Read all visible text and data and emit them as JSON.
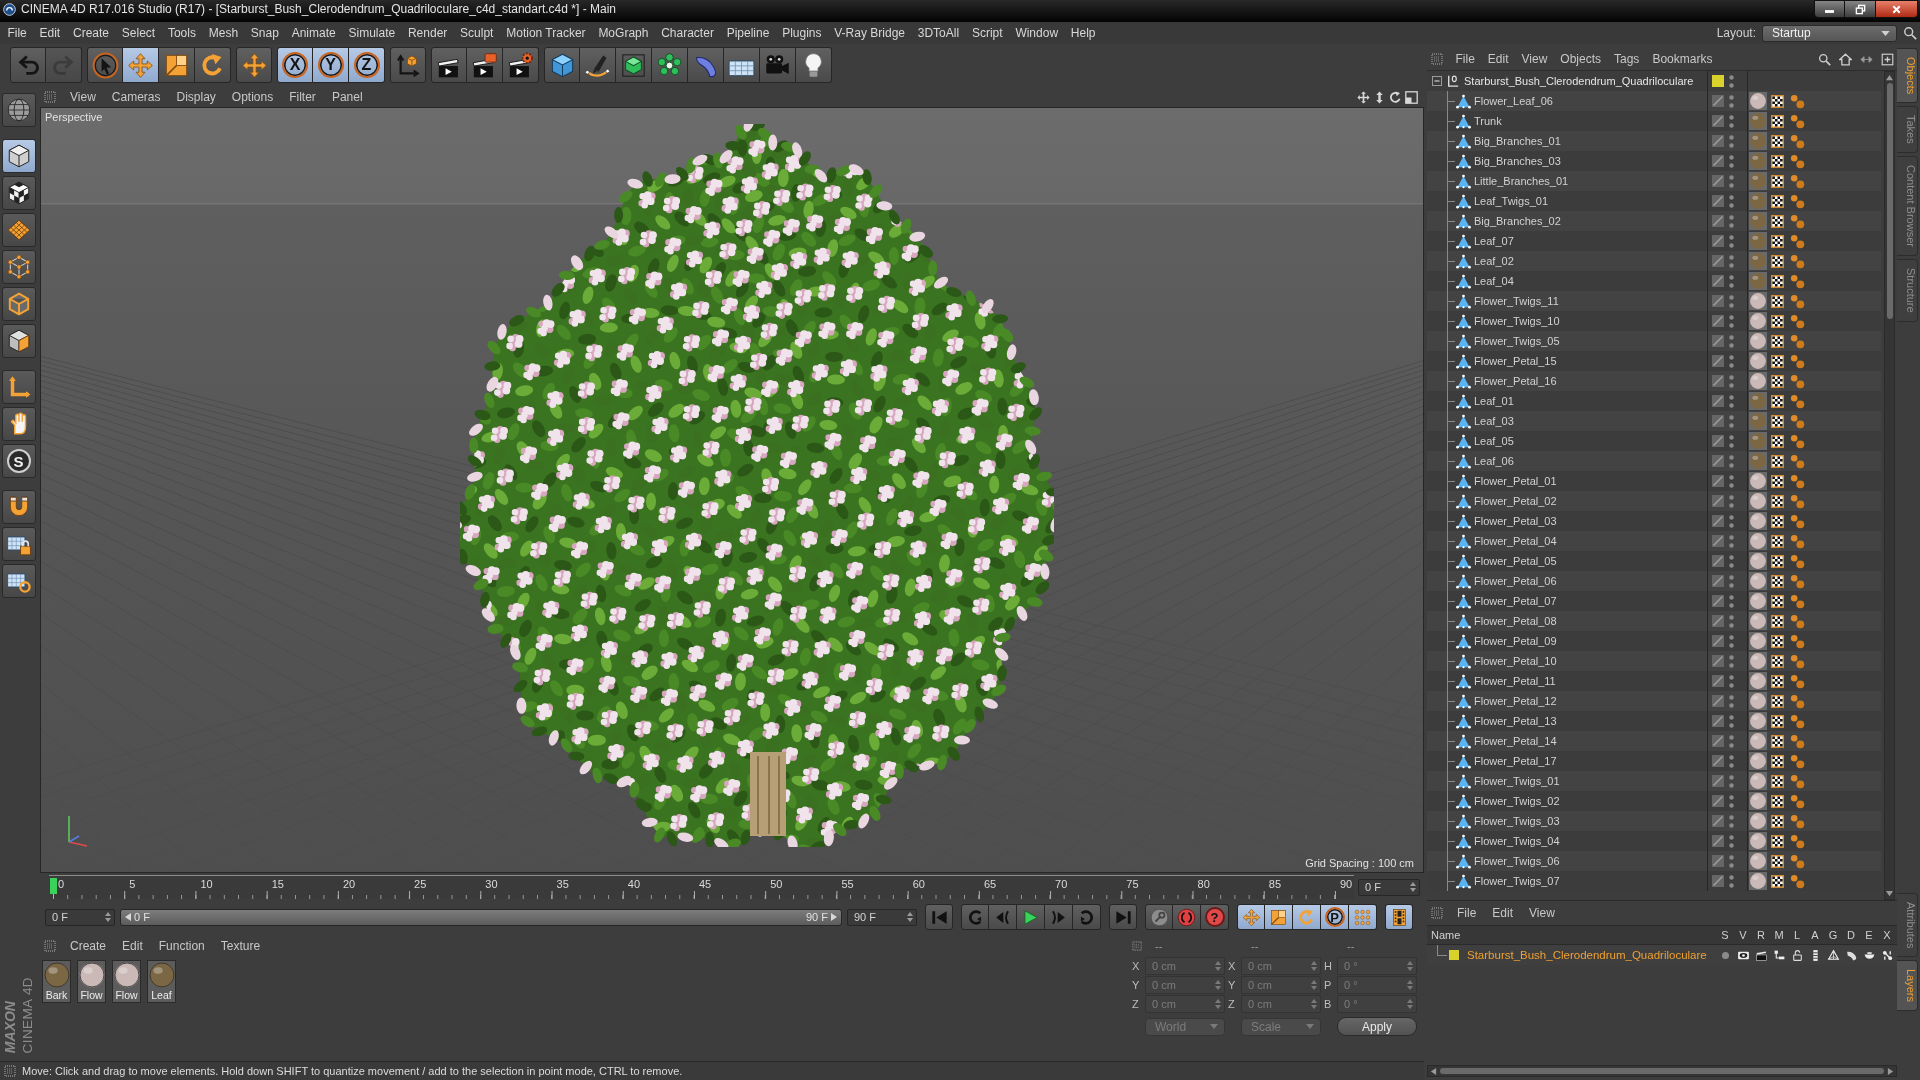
{
  "window": {
    "title": "CINEMA 4D R17.016 Studio (R17) - [Starburst_Bush_Clerodendrum_Quadriloculare_c4d_standart.c4d *] - Main"
  },
  "menu": [
    "File",
    "Edit",
    "Create",
    "Select",
    "Tools",
    "Mesh",
    "Snap",
    "Animate",
    "Simulate",
    "Render",
    "Sculpt",
    "Motion Tracker",
    "MoGraph",
    "Character",
    "Pipeline",
    "Plugins",
    "V-Ray Bridge",
    "3DToAll",
    "Script",
    "Window",
    "Help"
  ],
  "layout": {
    "label": "Layout:",
    "value": "Startup"
  },
  "toolbar_groups": [
    {
      "buttons": [
        {
          "active": false,
          "disabled": false
        },
        {
          "active": false,
          "disabled": true
        }
      ]
    },
    {
      "buttons": [
        {
          "active": false,
          "disabled": false
        },
        {
          "active": true,
          "disabled": false
        },
        {
          "active": false,
          "disabled": false
        },
        {
          "active": false,
          "disabled": false
        }
      ]
    },
    {
      "buttons": [
        {
          "active": false,
          "disabled": false
        }
      ]
    },
    {
      "buttons": [
        {
          "label": "X",
          "active": true,
          "disabled": false
        },
        {
          "label": "Y",
          "active": true,
          "disabled": false
        },
        {
          "label": "Z",
          "active": true,
          "disabled": false
        }
      ]
    },
    {
      "buttons": [
        {
          "active": false,
          "disabled": false
        }
      ]
    },
    {
      "buttons": [
        {
          "active": false,
          "disabled": false
        },
        {
          "active": false,
          "disabled": false
        },
        {
          "active": false,
          "disabled": false
        }
      ]
    },
    {
      "buttons": [
        {
          "active": false,
          "disabled": false
        },
        {
          "active": false,
          "disabled": false
        },
        {
          "active": false,
          "disabled": false
        },
        {
          "active": false,
          "disabled": false
        },
        {
          "active": false,
          "disabled": false
        },
        {
          "active": false,
          "disabled": false
        },
        {
          "active": false,
          "disabled": false
        },
        {
          "active": false,
          "disabled": false
        }
      ]
    }
  ],
  "mode_tools": [
    {
      "active": false
    },
    {
      "active": true
    },
    {
      "active": false
    },
    {
      "active": false
    },
    {
      "active": false
    },
    {
      "active": false
    },
    {
      "active": false
    },
    {
      "active": false
    },
    {
      "active": false
    },
    {
      "label": "S",
      "active": false
    },
    {
      "active": false
    },
    {
      "active": false
    },
    {
      "active": false
    }
  ],
  "logo": {
    "brand": "MAXON",
    "product": "CINEMA 4D"
  },
  "viewport": {
    "menu": [
      "View",
      "Cameras",
      "Display",
      "Options",
      "Filter",
      "Panel"
    ],
    "camera": "Perspective",
    "grid_spacing": "Grid Spacing : 100 cm"
  },
  "timeline": {
    "ticks": [
      "0",
      "5",
      "10",
      "15",
      "20",
      "25",
      "30",
      "35",
      "40",
      "45",
      "50",
      "55",
      "60",
      "65",
      "70",
      "75",
      "80",
      "85",
      "90"
    ],
    "level": 0,
    "frame": "0 F"
  },
  "transport": {
    "start": "0 F",
    "range_start": "0 F",
    "range_end": "90 F",
    "end": "90 F",
    "groups": [
      {
        "buttons": [
          {
            "active": false
          }
        ]
      },
      {
        "buttons": [
          {
            "active": false
          },
          {
            "active": false
          },
          {
            "active": false
          },
          {
            "active": false
          },
          {
            "active": false
          }
        ]
      },
      {
        "buttons": [
          {
            "active": false
          }
        ]
      },
      {
        "buttons": [
          {
            "active": false
          },
          {
            "active": false
          },
          {
            "label": "?",
            "active": false
          }
        ]
      },
      {
        "buttons": [
          {
            "active": true
          },
          {
            "active": true
          },
          {
            "active": true
          },
          {
            "label": "P",
            "active": true
          },
          {
            "active": true
          }
        ]
      },
      {
        "buttons": [
          {
            "active": true
          }
        ]
      }
    ]
  },
  "material_manager": {
    "menu": [
      "Create",
      "Edit",
      "Function",
      "Texture"
    ],
    "materials": [
      {
        "name": "Bark",
        "color": "#7c6745",
        "selected": false
      },
      {
        "name": "Flow",
        "color": "#cbb9b8",
        "selected": false
      },
      {
        "name": "Flow",
        "color": "#cbb9b8",
        "selected": false
      },
      {
        "name": "Leaf",
        "color": "#7c6745",
        "selected": false
      }
    ]
  },
  "coordinates": {
    "headers": [
      "--",
      "--",
      "--"
    ],
    "rows": [
      {
        "fields": [
          {
            "axis": "X",
            "value": "0 cm"
          },
          {
            "axis": "X",
            "value": "0 cm"
          },
          {
            "axis": "H",
            "value": "0 °"
          }
        ]
      },
      {
        "fields": [
          {
            "axis": "Y",
            "value": "0 cm"
          },
          {
            "axis": "Y",
            "value": "0 cm"
          },
          {
            "axis": "P",
            "value": "0 °"
          }
        ]
      },
      {
        "fields": [
          {
            "axis": "Z",
            "value": "0 cm"
          },
          {
            "axis": "Z",
            "value": "0 cm"
          },
          {
            "axis": "B",
            "value": "0 °"
          }
        ]
      }
    ],
    "dropdowns": [
      "World",
      "Scale"
    ],
    "apply": "Apply",
    "disabled": true
  },
  "status_bar": "Move: Click and drag to move elements. Hold down SHIFT to quantize movement / add to the selection in point mode, CTRL to remove.",
  "object_manager": {
    "menu": [
      "File",
      "Edit",
      "View",
      "Objects",
      "Tags",
      "Bookmarks"
    ],
    "root": {
      "name": "Starburst_Bush_Clerodendrum_Quadriloculare",
      "expanded": true,
      "selected": false,
      "color": "#d9d22c",
      "children": [
        {
          "name": "Flower_Leaf_06",
          "selected": false,
          "color": "#cbb9b8"
        },
        {
          "name": "Trunk",
          "selected": false,
          "color": "#7c6745"
        },
        {
          "name": "Big_Branches_01",
          "selected": false,
          "color": "#7c6745"
        },
        {
          "name": "Big_Branches_03",
          "selected": false,
          "color": "#7c6745"
        },
        {
          "name": "Little_Branches_01",
          "selected": false,
          "color": "#7c6745"
        },
        {
          "name": "Leaf_Twigs_01",
          "selected": false,
          "color": "#7c6745"
        },
        {
          "name": "Big_Branches_02",
          "selected": false,
          "color": "#7c6745"
        },
        {
          "name": "Leaf_07",
          "selected": false,
          "color": "#7c6745"
        },
        {
          "name": "Leaf_02",
          "selected": false,
          "color": "#7c6745"
        },
        {
          "name": "Leaf_04",
          "selected": false,
          "color": "#7c6745"
        },
        {
          "name": "Flower_Twigs_11",
          "selected": false,
          "color": "#cbb9b8"
        },
        {
          "name": "Flower_Twigs_10",
          "selected": false,
          "color": "#cbb9b8"
        },
        {
          "name": "Flower_Twigs_05",
          "selected": false,
          "color": "#cbb9b8"
        },
        {
          "name": "Flower_Petal_15",
          "selected": false,
          "color": "#cbb9b8"
        },
        {
          "name": "Flower_Petal_16",
          "selected": false,
          "color": "#cbb9b8"
        },
        {
          "name": "Leaf_01",
          "selected": false,
          "color": "#7c6745"
        },
        {
          "name": "Leaf_03",
          "selected": false,
          "color": "#7c6745"
        },
        {
          "name": "Leaf_05",
          "selected": false,
          "color": "#7c6745"
        },
        {
          "name": "Leaf_06",
          "selected": false,
          "color": "#7c6745"
        },
        {
          "name": "Flower_Petal_01",
          "selected": false,
          "color": "#cbb9b8"
        },
        {
          "name": "Flower_Petal_02",
          "selected": false,
          "color": "#cbb9b8"
        },
        {
          "name": "Flower_Petal_03",
          "selected": false,
          "color": "#cbb9b8"
        },
        {
          "name": "Flower_Petal_04",
          "selected": false,
          "color": "#cbb9b8"
        },
        {
          "name": "Flower_Petal_05",
          "selected": false,
          "color": "#cbb9b8"
        },
        {
          "name": "Flower_Petal_06",
          "selected": false,
          "color": "#cbb9b8"
        },
        {
          "name": "Flower_Petal_07",
          "selected": false,
          "color": "#cbb9b8"
        },
        {
          "name": "Flower_Petal_08",
          "selected": false,
          "color": "#cbb9b8"
        },
        {
          "name": "Flower_Petal_09",
          "selected": false,
          "color": "#cbb9b8"
        },
        {
          "name": "Flower_Petal_10",
          "selected": false,
          "color": "#cbb9b8"
        },
        {
          "name": "Flower_Petal_11",
          "selected": false,
          "color": "#cbb9b8"
        },
        {
          "name": "Flower_Petal_12",
          "selected": false,
          "color": "#cbb9b8"
        },
        {
          "name": "Flower_Petal_13",
          "selected": false,
          "color": "#cbb9b8"
        },
        {
          "name": "Flower_Petal_14",
          "selected": false,
          "color": "#cbb9b8"
        },
        {
          "name": "Flower_Petal_17",
          "selected": false,
          "color": "#cbb9b8"
        },
        {
          "name": "Flower_Twigs_01",
          "selected": false,
          "color": "#cbb9b8"
        },
        {
          "name": "Flower_Twigs_02",
          "selected": false,
          "color": "#cbb9b8"
        },
        {
          "name": "Flower_Twigs_03",
          "selected": false,
          "color": "#cbb9b8"
        },
        {
          "name": "Flower_Twigs_04",
          "selected": false,
          "color": "#cbb9b8"
        },
        {
          "name": "Flower_Twigs_06",
          "selected": false,
          "color": "#cbb9b8"
        },
        {
          "name": "Flower_Twigs_07",
          "selected": false,
          "color": "#cbb9b8"
        }
      ]
    }
  },
  "layer_manager": {
    "menu": [
      "File",
      "Edit",
      "View"
    ],
    "columns": [
      "Name",
      "S",
      "V",
      "R",
      "M",
      "L",
      "A",
      "G",
      "D",
      "E",
      "X"
    ],
    "layers": [
      {
        "name": "Starburst_Bush_Clerodendrum_Quadriloculare",
        "color": "#d9d22c",
        "selected": true
      }
    ]
  },
  "side_tabs": {
    "upper": [
      {
        "label": "Objects",
        "selected": true
      },
      {
        "label": "Takes",
        "selected": false
      },
      {
        "label": "Content Browser",
        "selected": false
      },
      {
        "label": "Structure",
        "selected": false
      }
    ],
    "lower": [
      {
        "label": "Attributes",
        "selected": false
      },
      {
        "label": "Layers",
        "selected": true
      }
    ]
  }
}
